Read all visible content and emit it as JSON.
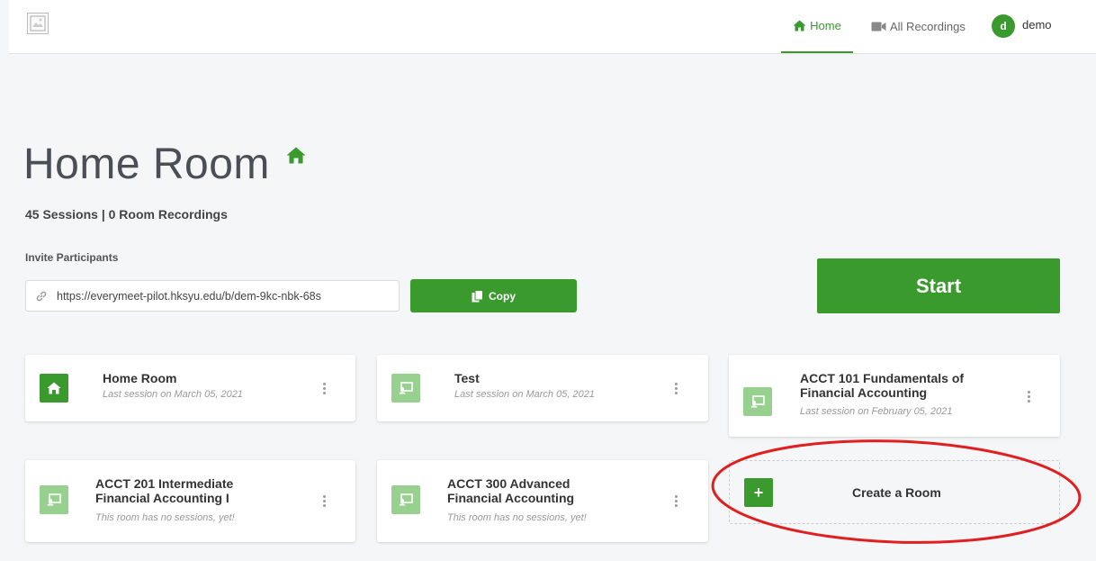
{
  "topbar": {
    "nav_home": "Home",
    "nav_recordings": "All Recordings",
    "avatar_letter": "d",
    "username": "demo"
  },
  "room": {
    "title": "Home Room",
    "stats": "45 Sessions | 0 Room Recordings",
    "invite_label": "Invite Participants",
    "invite_url": "https://everymeet-pilot.hksyu.edu/b/dem-9kc-nbk-68s",
    "copy_label": "Copy",
    "start_label": "Start"
  },
  "rooms": [
    {
      "name": "Home Room",
      "subtitle": "Last session on March 05, 2021",
      "icon": "home-icon",
      "active": true
    },
    {
      "name": "Test",
      "subtitle": "Last session on March 05, 2021",
      "icon": "room-icon",
      "active": false
    },
    {
      "name": "ACCT 101 Fundamentals of Financial Accounting",
      "subtitle": "Last session on February 05, 2021",
      "icon": "room-icon",
      "active": false
    },
    {
      "name": "ACCT 201 Intermediate Financial Accounting I",
      "subtitle": "This room has no sessions, yet!",
      "icon": "room-icon",
      "active": false
    },
    {
      "name": "ACCT 300 Advanced Financial Accounting",
      "subtitle": "This room has no sessions, yet!",
      "icon": "room-icon",
      "active": false
    }
  ],
  "create_room": {
    "label": "Create a Room",
    "plus": "+"
  },
  "colors": {
    "accent": "#3a9a2e",
    "accent_light": "#98d08f",
    "annotation": "#e02020"
  }
}
